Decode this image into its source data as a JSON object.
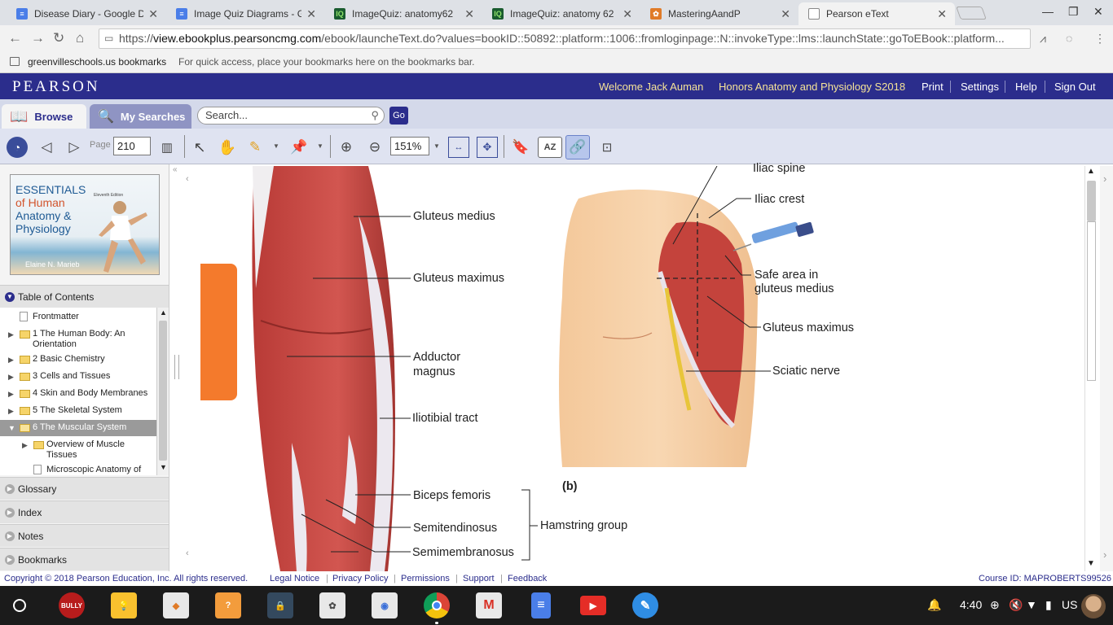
{
  "browser": {
    "tabs": [
      {
        "title": "Disease Diary - Google D",
        "icon": "docs-icon",
        "color": "#4a7ee8"
      },
      {
        "title": "Image Quiz Diagrams - G",
        "icon": "docs-icon",
        "color": "#4a7ee8"
      },
      {
        "title": "ImageQuiz: anatomy62",
        "icon": "imagequiz-icon",
        "color": "#1a5c2f"
      },
      {
        "title": "ImageQuiz: anatomy 62",
        "icon": "imagequiz-icon",
        "color": "#1a5c2f"
      },
      {
        "title": "MasteringAandP",
        "icon": "mastering-icon",
        "color": "#e07b28"
      },
      {
        "title": "Pearson eText",
        "icon": "page-icon",
        "color": "#888888"
      }
    ],
    "url_scheme": "https://",
    "url_host": "view.ebookplus.pearsoncmg.com",
    "url_path": "/ebook/launcheText.do?values=bookID::50892::platform::1006::fromloginpage::N::invokeType::lms::launchState::goToEBook::platform...",
    "bookmarks_folder": "greenvilleschools.us bookmarks",
    "bookmarks_hint": "For quick access, place your bookmarks here on the bookmarks bar."
  },
  "header": {
    "logo": "PEARSON",
    "welcome": "Welcome Jack Auman",
    "course": "Honors Anatomy and Physiology S2018",
    "links": [
      "Print",
      "Settings",
      "Help",
      "Sign Out"
    ]
  },
  "nav": {
    "browse": "Browse",
    "my_searches": "My Searches",
    "search_placeholder": "Search...",
    "go": "Go"
  },
  "tools": {
    "page_label": "Page",
    "page_value": "210",
    "zoom_value": "151%",
    "az_label": "AZ"
  },
  "sidebar": {
    "cover": {
      "title_line1": "ESSENTIALS",
      "title_line2": "of Human",
      "title_line3": "Anatomy &",
      "title_line4": "Physiology",
      "edition": "Eleventh Edition",
      "author": "Elaine N. Marieb"
    },
    "toc_header": "Table of Contents",
    "toc_items": [
      {
        "label": "Frontmatter",
        "line2": "",
        "kind": "file",
        "arrow": false
      },
      {
        "label": "1 The Human Body: An",
        "line2": "Orientation",
        "kind": "folder",
        "arrow": true
      },
      {
        "label": "2 Basic Chemistry",
        "line2": "",
        "kind": "folder",
        "arrow": true
      },
      {
        "label": "3 Cells and Tissues",
        "line2": "",
        "kind": "folder",
        "arrow": true
      },
      {
        "label": "4 Skin and Body Membranes",
        "line2": "",
        "kind": "folder",
        "arrow": true
      },
      {
        "label": "5 The Skeletal System",
        "line2": "",
        "kind": "folder",
        "arrow": true
      },
      {
        "label": "6 The Muscular System",
        "line2": "",
        "kind": "folder-open",
        "arrow": true
      },
      {
        "label": "Overview of Muscle",
        "line2": "Tissues",
        "kind": "folder",
        "arrow": true
      },
      {
        "label": "Microscopic Anatomy of",
        "line2": "",
        "kind": "file",
        "arrow": false
      }
    ],
    "sections": [
      "Glossary",
      "Index",
      "Notes",
      "Bookmarks"
    ]
  },
  "figure": {
    "labels_a": [
      "Gluteus medius",
      "Gluteus maximus",
      "Adductor",
      "magnus",
      "Iliotibial tract",
      "Biceps femoris",
      "Semitendinosus",
      "Semimembranosus",
      "Hamstring group"
    ],
    "labels_b": [
      "Iliac spine",
      "Iliac crest",
      "Safe area in",
      "gluteus medius",
      "Gluteus maximus",
      "Sciatic nerve"
    ],
    "panel_b": "(b)"
  },
  "footer": {
    "copyright": "Copyright © 2018 Pearson Education, Inc. All rights reserved.",
    "links": [
      "Legal Notice",
      "Privacy Policy",
      "Permissions",
      "Support",
      "Feedback"
    ],
    "course_id": "Course ID: MAPROBERTS99526"
  },
  "taskbar": {
    "apps": [
      {
        "name": "bully-app-icon",
        "label": "BULLY",
        "color": "#b71c1c"
      },
      {
        "name": "bulb-app-icon",
        "label": "💡",
        "color": "#f9c12e"
      },
      {
        "name": "app-icon",
        "label": "◆",
        "color": "#e8e8e8"
      },
      {
        "name": "quiz-app-icon",
        "label": "?",
        "color": "#f39c3c"
      },
      {
        "name": "lock-app-icon",
        "label": "🔒",
        "color": "#34495e"
      },
      {
        "name": "tree-app-icon",
        "label": "✿",
        "color": "#e8e8e8"
      },
      {
        "name": "owl-app-icon",
        "label": "◉",
        "color": "#e8e8e8"
      },
      {
        "name": "chrome-app-icon",
        "label": "",
        "color": "#1b1b1b"
      },
      {
        "name": "gmail-app-icon",
        "label": "M",
        "color": "#e8e8e8"
      },
      {
        "name": "docs-app-icon",
        "label": "≡",
        "color": "#4a7ee8"
      },
      {
        "name": "youtube-app-icon",
        "label": "▶",
        "color": "#e52d27"
      },
      {
        "name": "pen-app-icon",
        "label": "✎",
        "color": "#2f8de4"
      }
    ],
    "time": "4:40",
    "lang": "US"
  }
}
